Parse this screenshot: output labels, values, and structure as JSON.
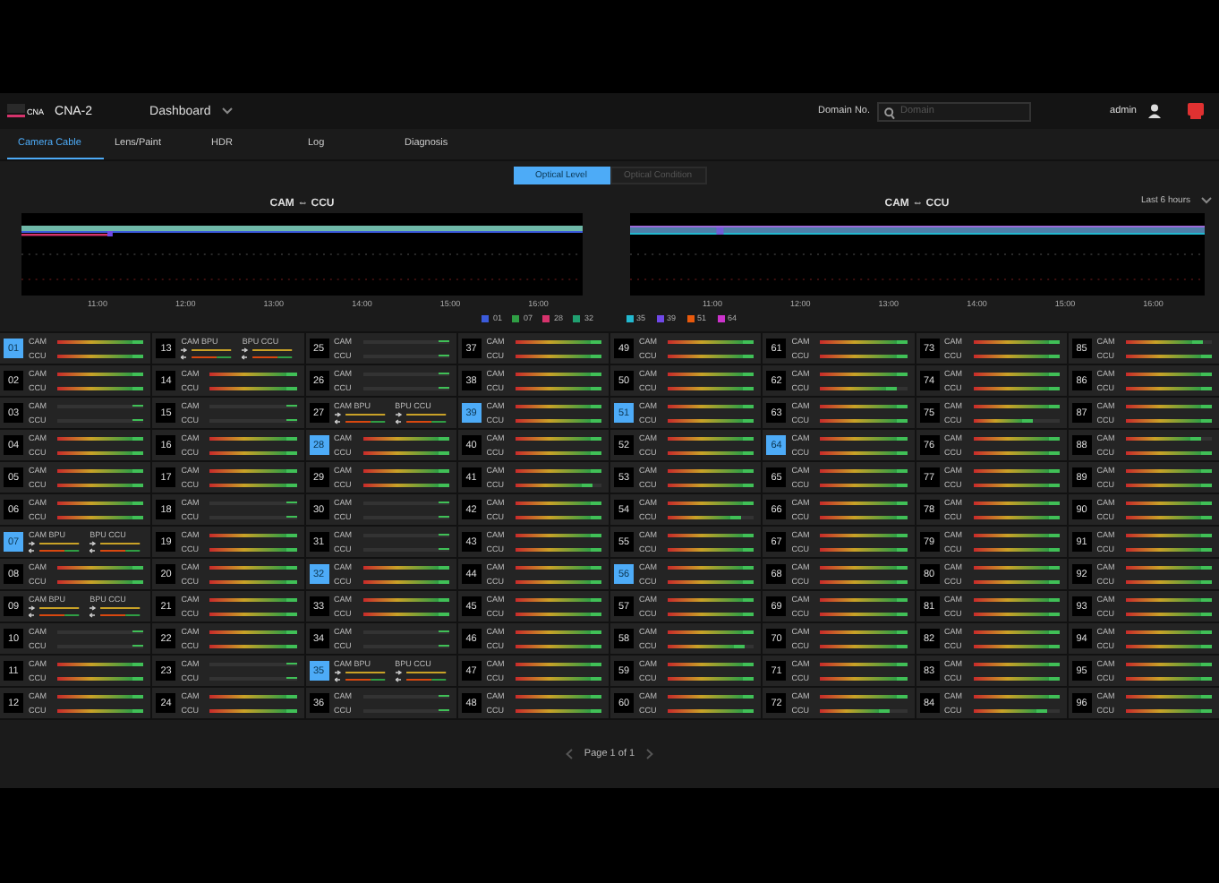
{
  "header": {
    "logo": "CNA",
    "product": "CNA-2",
    "menu": "Dashboard",
    "domain_label": "Domain No.",
    "domain_placeholder": "Domain",
    "user": "admin"
  },
  "tabs": [
    {
      "label": "Camera Cable",
      "selected": true
    },
    {
      "label": "Lens/Paint",
      "selected": false
    },
    {
      "label": "HDR",
      "selected": false
    },
    {
      "label": "Log",
      "selected": false
    },
    {
      "label": "Diagnosis",
      "selected": false
    }
  ],
  "modes": [
    {
      "label": "Optical Level",
      "selected": true
    },
    {
      "label": "Optical Condition",
      "selected": false
    }
  ],
  "charts": [
    {
      "title": "CAM ⇔ CCU",
      "x_labels": [
        "11:00",
        "12:00",
        "13:00",
        "14:00",
        "15:00",
        "16:00"
      ],
      "legend": [
        {
          "label": "01",
          "color": "#3b5bdb"
        },
        {
          "label": "07",
          "color": "#2f9e44"
        },
        {
          "label": "28",
          "color": "#d6336c"
        },
        {
          "label": "32",
          "color": "#20a070"
        }
      ]
    },
    {
      "title": "CAM ⇔ CCU",
      "range": "Last 6 hours",
      "x_labels": [
        "11:00",
        "12:00",
        "13:00",
        "14:00",
        "15:00",
        "16:00"
      ],
      "legend": [
        {
          "label": "35",
          "color": "#22b8cf"
        },
        {
          "label": "39",
          "color": "#7048e8"
        },
        {
          "label": "51",
          "color": "#e8590c"
        },
        {
          "label": "64",
          "color": "#cc33cc"
        }
      ]
    }
  ],
  "cells": [
    {
      "number": "01",
      "selected": true,
      "kind": "link",
      "lines": [
        {
          "label": "CAM",
          "level": 1
        },
        {
          "label": "CCU",
          "level": 1
        }
      ]
    },
    {
      "number": "02",
      "selected": false,
      "kind": "link",
      "lines": [
        {
          "label": "CAM",
          "level": 1
        },
        {
          "label": "CCU",
          "level": 1
        }
      ]
    },
    {
      "number": "03",
      "selected": false,
      "kind": "idle",
      "lines": [
        {
          "label": "CAM"
        },
        {
          "label": "CCU"
        }
      ]
    },
    {
      "number": "04",
      "selected": false,
      "kind": "link",
      "lines": [
        {
          "label": "CAM",
          "level": 1
        },
        {
          "label": "CCU",
          "level": 1
        }
      ]
    },
    {
      "number": "05",
      "selected": false,
      "kind": "link",
      "lines": [
        {
          "label": "CAM",
          "level": 1
        },
        {
          "label": "CCU",
          "level": 1
        }
      ]
    },
    {
      "number": "06",
      "selected": false,
      "kind": "link",
      "lines": [
        {
          "label": "CAM",
          "level": 1
        },
        {
          "label": "CCU",
          "level": 1
        }
      ]
    },
    {
      "number": "07",
      "selected": true,
      "kind": "bpu",
      "lines": [
        {
          "label": "CAM BPU"
        },
        {
          "label": "BPU CCU"
        }
      ]
    },
    {
      "number": "08",
      "selected": false,
      "kind": "link",
      "lines": [
        {
          "label": "CAM",
          "level": 1
        },
        {
          "label": "CCU",
          "level": 1
        }
      ]
    },
    {
      "number": "09",
      "selected": false,
      "kind": "bpu",
      "lines": [
        {
          "label": "CAM BPU"
        },
        {
          "label": "BPU CCU"
        }
      ]
    },
    {
      "number": "10",
      "selected": false,
      "kind": "idle",
      "lines": [
        {
          "label": "CAM"
        },
        {
          "label": "CCU"
        }
      ]
    },
    {
      "number": "11",
      "selected": false,
      "kind": "link",
      "lines": [
        {
          "label": "CAM",
          "level": 1
        },
        {
          "label": "CCU",
          "level": 1
        }
      ]
    },
    {
      "number": "12",
      "selected": false,
      "kind": "link",
      "lines": [
        {
          "label": "CAM",
          "level": 1
        },
        {
          "label": "CCU",
          "level": 1
        }
      ]
    },
    {
      "number": "13",
      "selected": false,
      "kind": "bpu",
      "lines": [
        {
          "label": "CAM BPU"
        },
        {
          "label": "BPU CCU"
        }
      ]
    },
    {
      "number": "14",
      "selected": false,
      "kind": "link",
      "lines": [
        {
          "label": "CAM",
          "level": 1
        },
        {
          "label": "CCU",
          "level": 1
        }
      ]
    },
    {
      "number": "15",
      "selected": false,
      "kind": "idle",
      "lines": [
        {
          "label": "CAM"
        },
        {
          "label": "CCU"
        }
      ]
    },
    {
      "number": "16",
      "selected": false,
      "kind": "link",
      "lines": [
        {
          "label": "CAM",
          "level": 1
        },
        {
          "label": "CCU",
          "level": 1
        }
      ]
    },
    {
      "number": "17",
      "selected": false,
      "kind": "link",
      "lines": [
        {
          "label": "CAM",
          "level": 1
        },
        {
          "label": "CCU",
          "level": 1
        }
      ]
    },
    {
      "number": "18",
      "selected": false,
      "kind": "idle",
      "lines": [
        {
          "label": "CAM"
        },
        {
          "label": "CCU"
        }
      ]
    },
    {
      "number": "19",
      "selected": false,
      "kind": "link",
      "lines": [
        {
          "label": "CAM",
          "level": 1
        },
        {
          "label": "CCU",
          "level": 1
        }
      ]
    },
    {
      "number": "20",
      "selected": false,
      "kind": "link",
      "lines": [
        {
          "label": "CAM",
          "level": 1
        },
        {
          "label": "CCU",
          "level": 1
        }
      ]
    },
    {
      "number": "21",
      "selected": false,
      "kind": "link",
      "lines": [
        {
          "label": "CAM",
          "level": 1
        },
        {
          "label": "CCU",
          "level": 1
        }
      ]
    },
    {
      "number": "22",
      "selected": false,
      "kind": "link",
      "lines": [
        {
          "label": "CAM",
          "level": 1
        },
        {
          "label": "CCU",
          "level": 1
        }
      ]
    },
    {
      "number": "23",
      "selected": false,
      "kind": "idle",
      "lines": [
        {
          "label": "CAM"
        },
        {
          "label": "CCU"
        }
      ]
    },
    {
      "number": "24",
      "selected": false,
      "kind": "link",
      "lines": [
        {
          "label": "CAM",
          "level": 1
        },
        {
          "label": "CCU",
          "level": 1
        }
      ]
    },
    {
      "number": "25",
      "selected": false,
      "kind": "idle",
      "lines": [
        {
          "label": "CAM"
        },
        {
          "label": "CCU"
        }
      ]
    },
    {
      "number": "26",
      "selected": false,
      "kind": "idle",
      "lines": [
        {
          "label": "CAM"
        },
        {
          "label": "CCU"
        }
      ]
    },
    {
      "number": "27",
      "selected": false,
      "kind": "bpu",
      "lines": [
        {
          "label": "CAM BPU"
        },
        {
          "label": "BPU CCU"
        }
      ]
    },
    {
      "number": "28",
      "selected": true,
      "kind": "link",
      "lines": [
        {
          "label": "CAM",
          "level": 1
        },
        {
          "label": "CCU",
          "level": 1
        }
      ]
    },
    {
      "number": "29",
      "selected": false,
      "kind": "link",
      "lines": [
        {
          "label": "CAM",
          "level": 1
        },
        {
          "label": "CCU",
          "level": 1
        }
      ]
    },
    {
      "number": "30",
      "selected": false,
      "kind": "idle",
      "lines": [
        {
          "label": "CAM"
        },
        {
          "label": "CCU"
        }
      ]
    },
    {
      "number": "31",
      "selected": false,
      "kind": "idle",
      "lines": [
        {
          "label": "CAM"
        },
        {
          "label": "CCU"
        }
      ]
    },
    {
      "number": "32",
      "selected": true,
      "kind": "link",
      "lines": [
        {
          "label": "CAM",
          "level": 1
        },
        {
          "label": "CCU",
          "level": 1
        }
      ]
    },
    {
      "number": "33",
      "selected": false,
      "kind": "link",
      "lines": [
        {
          "label": "CAM",
          "level": 1
        },
        {
          "label": "CCU",
          "level": 1
        }
      ]
    },
    {
      "number": "34",
      "selected": false,
      "kind": "idle",
      "lines": [
        {
          "label": "CAM"
        },
        {
          "label": "CCU"
        }
      ]
    },
    {
      "number": "35",
      "selected": true,
      "kind": "bpu",
      "lines": [
        {
          "label": "CAM BPU"
        },
        {
          "label": "BPU CCU"
        }
      ]
    },
    {
      "number": "36",
      "selected": false,
      "kind": "idle",
      "lines": [
        {
          "label": "CAM"
        },
        {
          "label": "CCU"
        }
      ]
    },
    {
      "number": "37",
      "selected": false,
      "kind": "link",
      "lines": [
        {
          "label": "CAM",
          "level": 1
        },
        {
          "label": "CCU",
          "level": 1
        }
      ]
    },
    {
      "number": "38",
      "selected": false,
      "kind": "link",
      "lines": [
        {
          "label": "CAM",
          "level": 1
        },
        {
          "label": "CCU",
          "level": 1
        }
      ]
    },
    {
      "number": "39",
      "selected": true,
      "kind": "link",
      "lines": [
        {
          "label": "CAM",
          "level": 1
        },
        {
          "label": "CCU",
          "level": 1
        }
      ]
    },
    {
      "number": "40",
      "selected": false,
      "kind": "link",
      "lines": [
        {
          "label": "CAM",
          "level": 1
        },
        {
          "label": "CCU",
          "level": 1
        }
      ]
    },
    {
      "number": "41",
      "selected": false,
      "kind": "link",
      "lines": [
        {
          "label": "CAM",
          "level": 1
        },
        {
          "label": "CCU",
          "level": 0.9
        }
      ]
    },
    {
      "number": "42",
      "selected": false,
      "kind": "link",
      "lines": [
        {
          "label": "CAM",
          "level": 1
        },
        {
          "label": "CCU",
          "level": 1
        }
      ]
    },
    {
      "number": "43",
      "selected": false,
      "kind": "link",
      "lines": [
        {
          "label": "CAM",
          "level": 1
        },
        {
          "label": "CCU",
          "level": 1
        }
      ]
    },
    {
      "number": "44",
      "selected": false,
      "kind": "link",
      "lines": [
        {
          "label": "CAM",
          "level": 1
        },
        {
          "label": "CCU",
          "level": 1
        }
      ]
    },
    {
      "number": "45",
      "selected": false,
      "kind": "link",
      "lines": [
        {
          "label": "CAM",
          "level": 1
        },
        {
          "label": "CCU",
          "level": 1
        }
      ]
    },
    {
      "number": "46",
      "selected": false,
      "kind": "link",
      "lines": [
        {
          "label": "CAM",
          "level": 1
        },
        {
          "label": "CCU",
          "level": 1
        }
      ]
    },
    {
      "number": "47",
      "selected": false,
      "kind": "link",
      "lines": [
        {
          "label": "CAM",
          "level": 1
        },
        {
          "label": "CCU",
          "level": 1
        }
      ]
    },
    {
      "number": "48",
      "selected": false,
      "kind": "link",
      "lines": [
        {
          "label": "CAM",
          "level": 1
        },
        {
          "label": "CCU",
          "level": 1
        }
      ]
    },
    {
      "number": "49",
      "selected": false,
      "kind": "link",
      "lines": [
        {
          "label": "CAM",
          "level": 1
        },
        {
          "label": "CCU",
          "level": 1
        }
      ]
    },
    {
      "number": "50",
      "selected": false,
      "kind": "link",
      "lines": [
        {
          "label": "CAM",
          "level": 1
        },
        {
          "label": "CCU",
          "level": 1
        }
      ]
    },
    {
      "number": "51",
      "selected": true,
      "kind": "link",
      "lines": [
        {
          "label": "CAM",
          "level": 1
        },
        {
          "label": "CCU",
          "level": 1
        }
      ]
    },
    {
      "number": "52",
      "selected": false,
      "kind": "link",
      "lines": [
        {
          "label": "CAM",
          "level": 1
        },
        {
          "label": "CCU",
          "level": 1
        }
      ]
    },
    {
      "number": "53",
      "selected": false,
      "kind": "link",
      "lines": [
        {
          "label": "CAM",
          "level": 1
        },
        {
          "label": "CCU",
          "level": 1
        }
      ]
    },
    {
      "number": "54",
      "selected": false,
      "kind": "link",
      "lines": [
        {
          "label": "CAM",
          "level": 1
        },
        {
          "label": "CCU",
          "level": 0.85
        }
      ]
    },
    {
      "number": "55",
      "selected": false,
      "kind": "link",
      "lines": [
        {
          "label": "CAM",
          "level": 1
        },
        {
          "label": "CCU",
          "level": 1
        }
      ]
    },
    {
      "number": "56",
      "selected": true,
      "kind": "link",
      "lines": [
        {
          "label": "CAM",
          "level": 1
        },
        {
          "label": "CCU",
          "level": 1
        }
      ]
    },
    {
      "number": "57",
      "selected": false,
      "kind": "link",
      "lines": [
        {
          "label": "CAM",
          "level": 1
        },
        {
          "label": "CCU",
          "level": 1
        }
      ]
    },
    {
      "number": "58",
      "selected": false,
      "kind": "link",
      "lines": [
        {
          "label": "CAM",
          "level": 1
        },
        {
          "label": "CCU",
          "level": 0.9
        }
      ]
    },
    {
      "number": "59",
      "selected": false,
      "kind": "link",
      "lines": [
        {
          "label": "CAM",
          "level": 1
        },
        {
          "label": "CCU",
          "level": 1
        }
      ]
    },
    {
      "number": "60",
      "selected": false,
      "kind": "link",
      "lines": [
        {
          "label": "CAM",
          "level": 1
        },
        {
          "label": "CCU",
          "level": 1
        }
      ]
    },
    {
      "number": "61",
      "selected": false,
      "kind": "link",
      "lines": [
        {
          "label": "CAM",
          "level": 1
        },
        {
          "label": "CCU",
          "level": 1
        }
      ]
    },
    {
      "number": "62",
      "selected": false,
      "kind": "link",
      "lines": [
        {
          "label": "CAM",
          "level": 1
        },
        {
          "label": "CCU",
          "level": 0.88
        }
      ]
    },
    {
      "number": "63",
      "selected": false,
      "kind": "link",
      "lines": [
        {
          "label": "CAM",
          "level": 1
        },
        {
          "label": "CCU",
          "level": 1
        }
      ]
    },
    {
      "number": "64",
      "selected": true,
      "kind": "link",
      "lines": [
        {
          "label": "CAM",
          "level": 1
        },
        {
          "label": "CCU",
          "level": 1
        }
      ]
    },
    {
      "number": "65",
      "selected": false,
      "kind": "link",
      "lines": [
        {
          "label": "CAM",
          "level": 1
        },
        {
          "label": "CCU",
          "level": 1
        }
      ]
    },
    {
      "number": "66",
      "selected": false,
      "kind": "link",
      "lines": [
        {
          "label": "CAM",
          "level": 1
        },
        {
          "label": "CCU",
          "level": 1
        }
      ]
    },
    {
      "number": "67",
      "selected": false,
      "kind": "link",
      "lines": [
        {
          "label": "CAM",
          "level": 1
        },
        {
          "label": "CCU",
          "level": 1
        }
      ]
    },
    {
      "number": "68",
      "selected": false,
      "kind": "link",
      "lines": [
        {
          "label": "CAM",
          "level": 1
        },
        {
          "label": "CCU",
          "level": 1
        }
      ]
    },
    {
      "number": "69",
      "selected": false,
      "kind": "link",
      "lines": [
        {
          "label": "CAM",
          "level": 1
        },
        {
          "label": "CCU",
          "level": 1
        }
      ]
    },
    {
      "number": "70",
      "selected": false,
      "kind": "link",
      "lines": [
        {
          "label": "CAM",
          "level": 1
        },
        {
          "label": "CCU",
          "level": 1
        }
      ]
    },
    {
      "number": "71",
      "selected": false,
      "kind": "link",
      "lines": [
        {
          "label": "CAM",
          "level": 1
        },
        {
          "label": "CCU",
          "level": 1
        }
      ]
    },
    {
      "number": "72",
      "selected": false,
      "kind": "link",
      "lines": [
        {
          "label": "CAM",
          "level": 1
        },
        {
          "label": "CCU",
          "level": 0.8
        }
      ]
    },
    {
      "number": "73",
      "selected": false,
      "kind": "link",
      "lines": [
        {
          "label": "CAM",
          "level": 1
        },
        {
          "label": "CCU",
          "level": 1
        }
      ]
    },
    {
      "number": "74",
      "selected": false,
      "kind": "link",
      "lines": [
        {
          "label": "CAM",
          "level": 1
        },
        {
          "label": "CCU",
          "level": 1
        }
      ]
    },
    {
      "number": "75",
      "selected": false,
      "kind": "link",
      "lines": [
        {
          "label": "CAM",
          "level": 1
        },
        {
          "label": "CCU",
          "level": 0.7
        }
      ]
    },
    {
      "number": "76",
      "selected": false,
      "kind": "link",
      "lines": [
        {
          "label": "CAM",
          "level": 1
        },
        {
          "label": "CCU",
          "level": 1
        }
      ]
    },
    {
      "number": "77",
      "selected": false,
      "kind": "link",
      "lines": [
        {
          "label": "CAM",
          "level": 1
        },
        {
          "label": "CCU",
          "level": 1
        }
      ]
    },
    {
      "number": "78",
      "selected": false,
      "kind": "link",
      "lines": [
        {
          "label": "CAM",
          "level": 1
        },
        {
          "label": "CCU",
          "level": 1
        }
      ]
    },
    {
      "number": "79",
      "selected": false,
      "kind": "link",
      "lines": [
        {
          "label": "CAM",
          "level": 1
        },
        {
          "label": "CCU",
          "level": 1
        }
      ]
    },
    {
      "number": "80",
      "selected": false,
      "kind": "link",
      "lines": [
        {
          "label": "CAM",
          "level": 1
        },
        {
          "label": "CCU",
          "level": 1
        }
      ]
    },
    {
      "number": "81",
      "selected": false,
      "kind": "link",
      "lines": [
        {
          "label": "CAM",
          "level": 1
        },
        {
          "label": "CCU",
          "level": 1
        }
      ]
    },
    {
      "number": "82",
      "selected": false,
      "kind": "link",
      "lines": [
        {
          "label": "CAM",
          "level": 1
        },
        {
          "label": "CCU",
          "level": 1
        }
      ]
    },
    {
      "number": "83",
      "selected": false,
      "kind": "link",
      "lines": [
        {
          "label": "CAM",
          "level": 1
        },
        {
          "label": "CCU",
          "level": 1
        }
      ]
    },
    {
      "number": "84",
      "selected": false,
      "kind": "link",
      "lines": [
        {
          "label": "CAM",
          "level": 1
        },
        {
          "label": "CCU",
          "level": 0.85
        }
      ]
    },
    {
      "number": "85",
      "selected": false,
      "kind": "link",
      "lines": [
        {
          "label": "CAM",
          "level": 0.9
        },
        {
          "label": "CCU",
          "level": 1
        }
      ]
    },
    {
      "number": "86",
      "selected": false,
      "kind": "link",
      "lines": [
        {
          "label": "CAM",
          "level": 1
        },
        {
          "label": "CCU",
          "level": 1
        }
      ]
    },
    {
      "number": "87",
      "selected": false,
      "kind": "link",
      "lines": [
        {
          "label": "CAM",
          "level": 1
        },
        {
          "label": "CCU",
          "level": 1
        }
      ]
    },
    {
      "number": "88",
      "selected": false,
      "kind": "link",
      "lines": [
        {
          "label": "CAM",
          "level": 0.88
        },
        {
          "label": "CCU",
          "level": 1
        }
      ]
    },
    {
      "number": "89",
      "selected": false,
      "kind": "link",
      "lines": [
        {
          "label": "CAM",
          "level": 1
        },
        {
          "label": "CCU",
          "level": 1
        }
      ]
    },
    {
      "number": "90",
      "selected": false,
      "kind": "link",
      "lines": [
        {
          "label": "CAM",
          "level": 1
        },
        {
          "label": "CCU",
          "level": 1
        }
      ]
    },
    {
      "number": "91",
      "selected": false,
      "kind": "link",
      "lines": [
        {
          "label": "CAM",
          "level": 1
        },
        {
          "label": "CCU",
          "level": 1
        }
      ]
    },
    {
      "number": "92",
      "selected": false,
      "kind": "link",
      "lines": [
        {
          "label": "CAM",
          "level": 1
        },
        {
          "label": "CCU",
          "level": 1
        }
      ]
    },
    {
      "number": "93",
      "selected": false,
      "kind": "link",
      "lines": [
        {
          "label": "CAM",
          "level": 1
        },
        {
          "label": "CCU",
          "level": 1
        }
      ]
    },
    {
      "number": "94",
      "selected": false,
      "kind": "link",
      "lines": [
        {
          "label": "CAM",
          "level": 1
        },
        {
          "label": "CCU",
          "level": 1
        }
      ]
    },
    {
      "number": "95",
      "selected": false,
      "kind": "link",
      "lines": [
        {
          "label": "CAM",
          "level": 1
        },
        {
          "label": "CCU",
          "level": 1
        }
      ]
    },
    {
      "number": "96",
      "selected": false,
      "kind": "link",
      "lines": [
        {
          "label": "CAM",
          "level": 1
        },
        {
          "label": "CCU",
          "level": 1
        }
      ]
    }
  ],
  "pagination": "Page 1 of 1"
}
